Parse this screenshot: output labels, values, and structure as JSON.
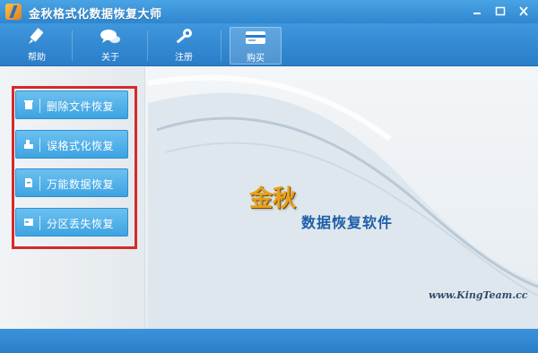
{
  "window": {
    "title": "金秋格式化数据恢复大师",
    "controls": [
      "minimize",
      "maximize",
      "close"
    ]
  },
  "toolbar": {
    "items": [
      {
        "label": "帮助",
        "icon": "help-pen-icon"
      },
      {
        "label": "关于",
        "icon": "chat-bubbles-icon"
      },
      {
        "label": "注册",
        "icon": "key-icon"
      },
      {
        "label": "购买",
        "icon": "card-icon",
        "active": true
      }
    ]
  },
  "menu": {
    "items": [
      {
        "label": "删除文件恢复",
        "icon": "trash-icon"
      },
      {
        "label": "误格式化恢复",
        "icon": "format-icon"
      },
      {
        "label": "万能数据恢复",
        "icon": "file-icon"
      },
      {
        "label": "分区丢失恢复",
        "icon": "partition-icon"
      }
    ]
  },
  "banner": {
    "brand": "金秋",
    "subtitle": "数据恢复软件",
    "site": "www.KingTeam.cc"
  },
  "colors": {
    "titlebar": "#3a94da",
    "menu_button": "#4fb0e8",
    "highlight_box": "#d42a2a",
    "brand_gold": "#e8a21a",
    "brand_blue": "#1d5fa8"
  }
}
